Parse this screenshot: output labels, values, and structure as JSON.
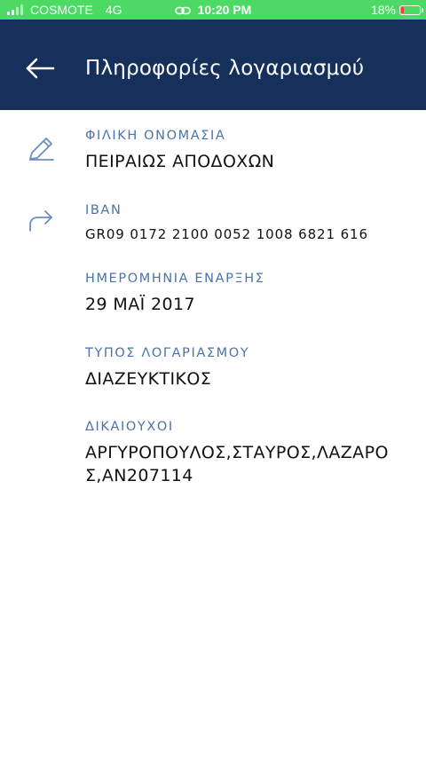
{
  "status_bar": {
    "carrier": "COSMOTE",
    "network": "4G",
    "time": "10:20 PM",
    "battery": "18%",
    "battery_level": 0.18,
    "background_color": "#4cd964",
    "battery_color": "#ff3b30"
  },
  "header": {
    "title": "Πληροφορίες λογαριασμού",
    "background_color": "#16305c",
    "back_icon": "arrow-left-icon"
  },
  "fields": {
    "friendly_name": {
      "label": "ΦΙΛΙΚΗ ΟΝΟΜΑΣΙΑ",
      "value": "ΠΕΙΡΑΙΩΣ ΑΠΟΔΟΧΩΝ",
      "icon": "pencil-icon"
    },
    "iban": {
      "label": "IBAN",
      "value": "GR09 0172 2100 0052 1008 6821 616",
      "icon": "share-arrow-icon"
    },
    "start_date": {
      "label": "ΗΜΕΡΟΜΗΝΙΑ ΕΝΑΡΞΗΣ",
      "value": "29 ΜΑΪ 2017"
    },
    "account_type": {
      "label": "ΤΥΠΟΣ ΛΟΓΑΡΙΑΣΜΟΥ",
      "value": "ΔΙΑΖΕΥΚΤΙΚΟΣ"
    },
    "beneficiaries": {
      "label": "ΔΙΚΑΙΟΥΧΟΙ",
      "value": "ΑΡΓΥΡΟΠΟΥΛΟΣ,ΣΤΑΥΡΟΣ,ΛΑΖΑΡΟΣ,ΑΝ207114"
    }
  },
  "colors": {
    "label": "#4a74a8",
    "icon": "#6b8fbf",
    "value": "#111111"
  }
}
